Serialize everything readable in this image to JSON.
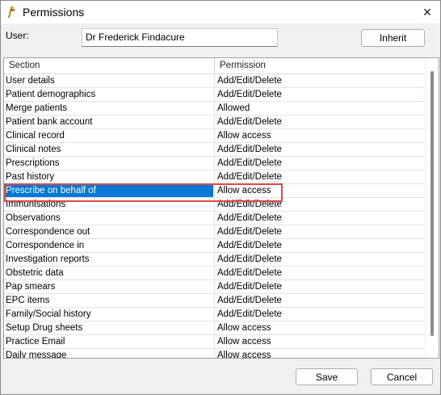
{
  "window": {
    "title": "Permissions",
    "close_glyph": "✕"
  },
  "user": {
    "label": "User:",
    "value": "Dr Frederick Findacure",
    "inherit_label": "Inherit"
  },
  "grid": {
    "columns": [
      "Section",
      "Permission"
    ],
    "rows": [
      {
        "section": "User details",
        "permission": "Add/Edit/Delete"
      },
      {
        "section": "Patient demographics",
        "permission": "Add/Edit/Delete"
      },
      {
        "section": "Merge patients",
        "permission": "Allowed"
      },
      {
        "section": "Patient bank account",
        "permission": "Add/Edit/Delete"
      },
      {
        "section": "Clinical record",
        "permission": "Allow access"
      },
      {
        "section": "Clinical notes",
        "permission": "Add/Edit/Delete"
      },
      {
        "section": "Prescriptions",
        "permission": "Add/Edit/Delete"
      },
      {
        "section": "Past history",
        "permission": "Add/Edit/Delete"
      },
      {
        "section": "Prescribe on behalf of",
        "permission": "Allow access",
        "selected": true
      },
      {
        "section": "Immunisations",
        "permission": "Add/Edit/Delete"
      },
      {
        "section": "Observations",
        "permission": "Add/Edit/Delete"
      },
      {
        "section": "Correspondence out",
        "permission": "Add/Edit/Delete"
      },
      {
        "section": "Correspondence in",
        "permission": "Add/Edit/Delete"
      },
      {
        "section": "Investigation reports",
        "permission": "Add/Edit/Delete"
      },
      {
        "section": "Obstetric data",
        "permission": "Add/Edit/Delete"
      },
      {
        "section": "Pap smears",
        "permission": "Add/Edit/Delete"
      },
      {
        "section": "EPC items",
        "permission": "Add/Edit/Delete"
      },
      {
        "section": "Family/Social history",
        "permission": "Add/Edit/Delete"
      },
      {
        "section": "Setup Drug sheets",
        "permission": "Allow access"
      },
      {
        "section": "Practice Email",
        "permission": "Allow access"
      },
      {
        "section": "Daily message",
        "permission": "Allow access"
      }
    ]
  },
  "footer": {
    "save_label": "Save",
    "cancel_label": "Cancel"
  },
  "colors": {
    "selection": "#0078d7",
    "highlight_border": "#e04848"
  },
  "icons": {
    "app": "app-logo-icon",
    "close": "close-icon"
  }
}
